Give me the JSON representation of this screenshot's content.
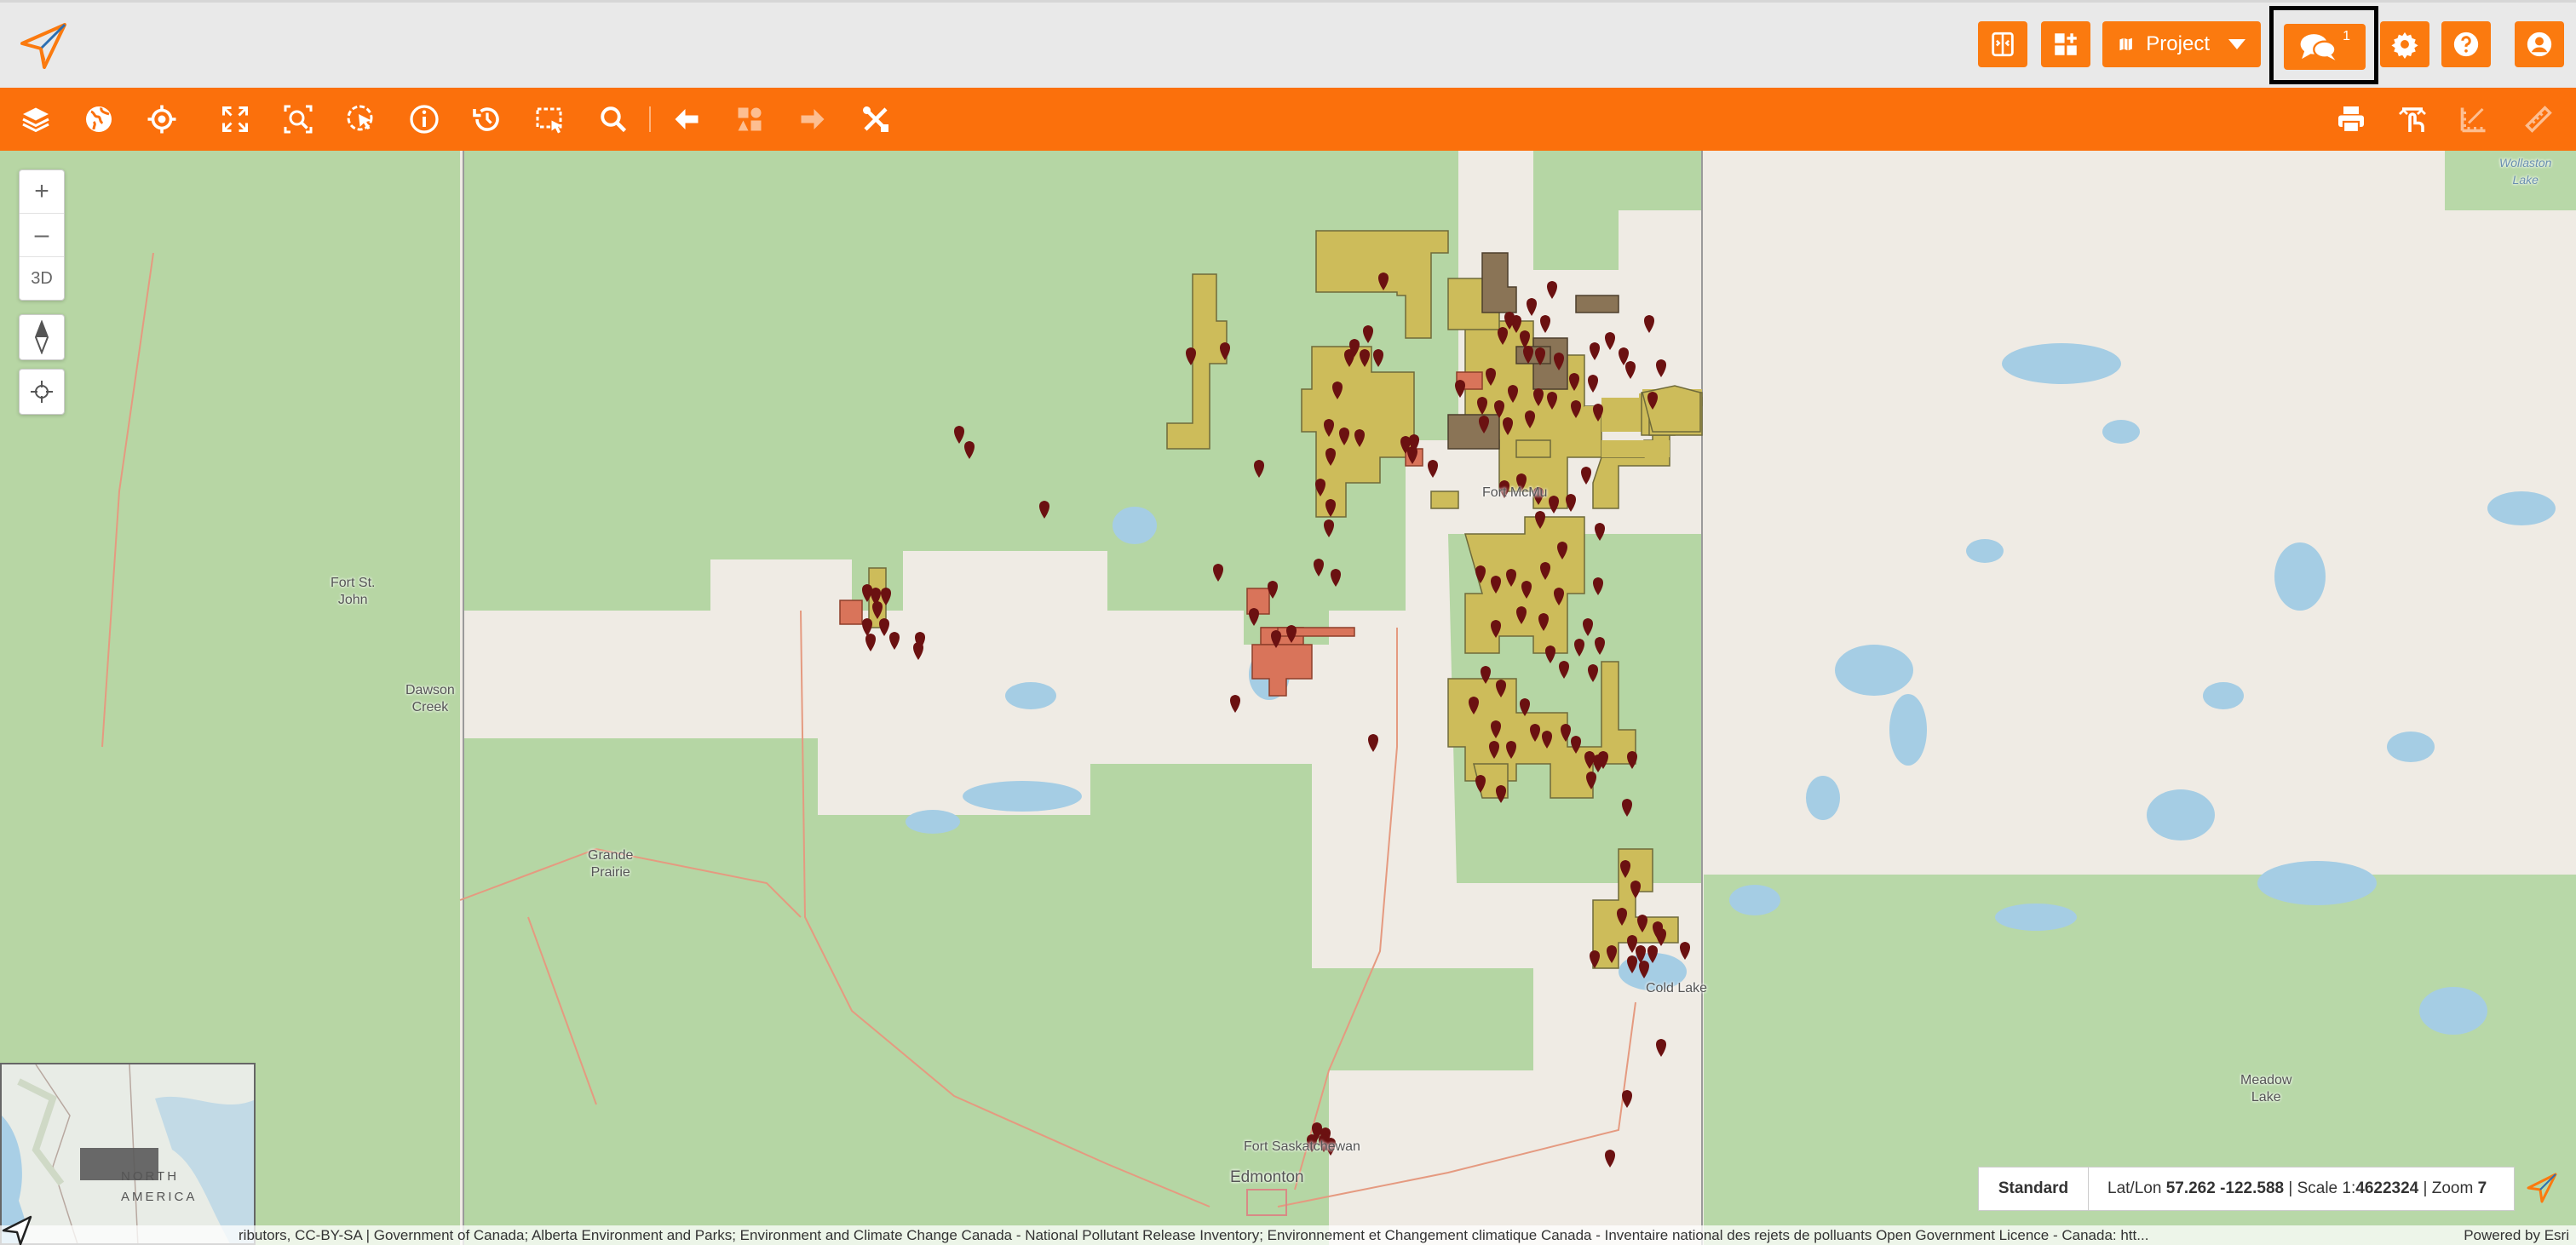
{
  "header": {
    "project_label": "Project",
    "chat_badge": "1"
  },
  "icons": {
    "logo": "app-logo-icon",
    "layers": "layers-icon",
    "basemap": "globe-icon",
    "locate": "crosshair-icon",
    "extent": "full-extent-icon",
    "zoom_select": "zoom-select-icon",
    "identify_click": "identify-click-icon",
    "info": "info-icon",
    "history": "history-icon",
    "select_area": "select-area-icon",
    "search": "search-icon",
    "back": "arrow-left-icon",
    "feature_select": "feature-select-icon",
    "forward": "arrow-right-icon",
    "tools": "tools-icon",
    "print": "print-icon",
    "swipe": "swipe-icon",
    "measure_area": "measure-area-icon",
    "measure": "ruler-icon"
  },
  "colors": {
    "accent": "#fb700c",
    "lease_yellow": "#cdbc5a",
    "lease_brown": "#8a7456",
    "lease_red": "#d9745a",
    "marker": "#6b1111",
    "forest": "#b5d6a4",
    "water": "#a5cde4"
  },
  "map_controls": {
    "zoom_in": "+",
    "zoom_out": "–",
    "three_d": "3D"
  },
  "labels": {
    "fort_st_john": "Fort St.\nJohn",
    "dawson_creek": "Dawson\nCreek",
    "grande_prairie": "Grande\nPrairie",
    "fort_mcmurray": "Fort McMu",
    "fort_saskatchewan": "Fort Saskatchewan",
    "edmonton": "Edmonton",
    "cold_lake": "Cold Lake",
    "meadow_lake": "Meadow\nLake",
    "wollaston_lake": "Wollaston\nLake"
  },
  "overview": {
    "label": "NORTH\nAMERICA"
  },
  "status": {
    "basemap": "Standard",
    "latlon_label": "Lat/Lon",
    "latlon_value": "57.262 -122.588",
    "scale_label": "Scale 1:",
    "scale_value": "4622324",
    "zoom_label": "Zoom",
    "zoom_value": "7"
  },
  "attribution": {
    "text": "ributors, CC-BY-SA | Government of Canada; Alberta Environment and Parks; Environment and Climate Change Canada - National Pollutant Release Inventory; Environnement et Changement climatique Canada - Inventaire national des rejets de polluants Open Government Licence - Canada: htt...",
    "powered_by": "Powered by Esri"
  }
}
